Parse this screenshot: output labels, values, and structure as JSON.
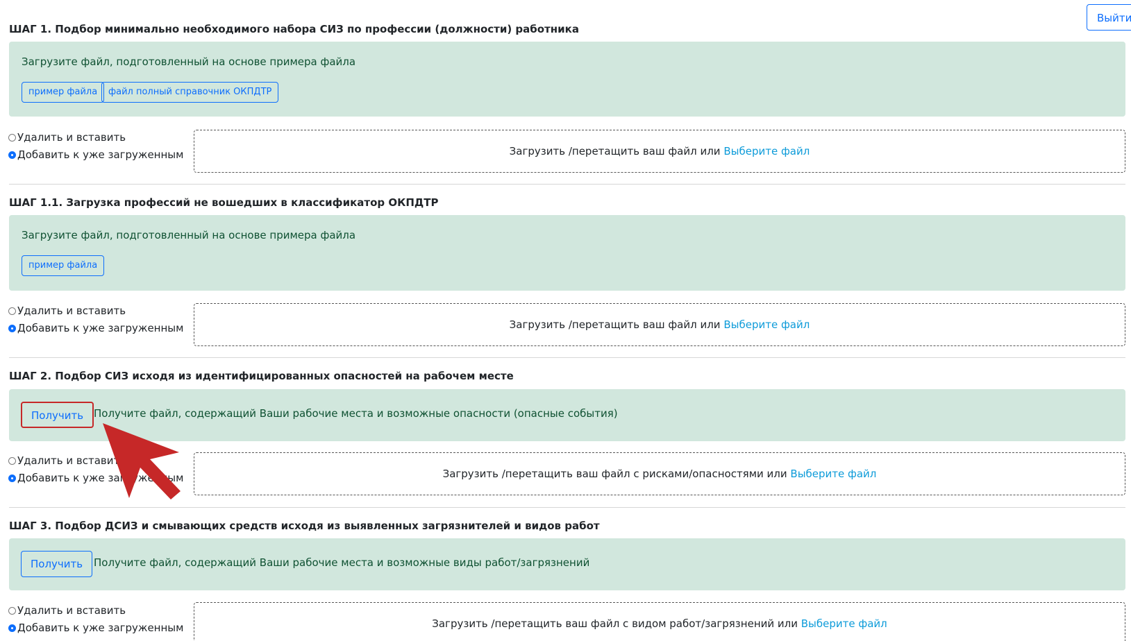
{
  "header": {
    "logout_label": "Выйти"
  },
  "radio_options": {
    "replace_label": "Удалить и вставить",
    "append_label": "Добавить к уже загруженным"
  },
  "dropzone": {
    "prefix": "Загрузить /перетащить ваш файл или",
    "prefix_risks": "Загрузить /перетащить ваш файл с рисками/опасностями или",
    "prefix_works": "Загрузить /перетащить ваш файл с видом работ/загрязнений или",
    "link_label": "Выберите файл"
  },
  "steps": [
    {
      "title": "ШАГ 1. Подбор минимально необходимого набора СИЗ по профессии (должности) работника",
      "info_text": "Загрузите файл, подготовленный на основе примера файла",
      "buttons": [
        "пример файла",
        "файл полный справочник ОКПДТР"
      ]
    },
    {
      "title": "ШАГ 1.1. Загрузка профессий не вошедших в классификатор ОКПДТР",
      "info_text": "Загрузите файл, подготовленный на основе примера файла",
      "buttons": [
        "пример файла"
      ]
    },
    {
      "title": "ШАГ 2. Подбор СИЗ исходя из идентифицированных опасностей на рабочем месте",
      "get_label": "Получить",
      "info_text": "Получите файл, содержащий Ваши рабочие места и возможные опасности (опасные события)"
    },
    {
      "title": "ШАГ 3. Подбор ДСИЗ и смывающих средств исходя из выявленных загрязнителей и видов работ",
      "get_label": "Получить",
      "info_text": "Получите файл, содержащий Ваши рабочие места и возможные виды работ/загрязнений"
    }
  ],
  "colors": {
    "accent": "#0d6efd",
    "info_bg": "#d1e7dd",
    "info_text": "#0f5132",
    "link": "#0d9bd9",
    "highlight": "#c62828"
  },
  "icons": {
    "pointer": "red-arrow-icon"
  }
}
